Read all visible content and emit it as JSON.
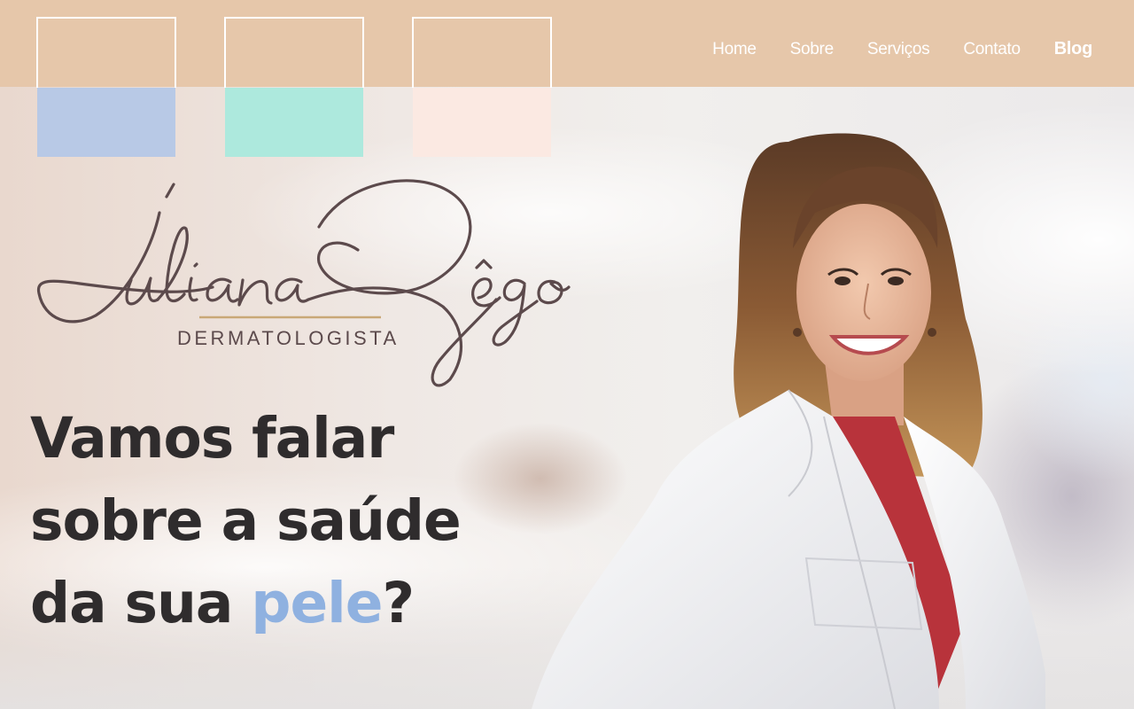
{
  "nav": {
    "items": [
      {
        "label": "Home"
      },
      {
        "label": "Sobre"
      },
      {
        "label": "Serviços"
      },
      {
        "label": "Contato"
      },
      {
        "label": "Blog"
      }
    ]
  },
  "palette": {
    "swatches": [
      "#b8c9e6",
      "#ade9dd",
      "#fbe9e2"
    ]
  },
  "logo": {
    "name": "JulianaRêgo",
    "subtitle": "DERMATOLOGISTA"
  },
  "hero": {
    "line1": "Vamos falar",
    "line2": "sobre a saúde",
    "line3_pre": "da sua ",
    "line3_highlight": "pele",
    "line3_post": "?"
  },
  "colors": {
    "header": "#e6c7aa",
    "highlight": "#8fb1e0",
    "headline": "#2f2c2d",
    "logo": "#5c4a4c",
    "logo_line": "#c9a877"
  }
}
